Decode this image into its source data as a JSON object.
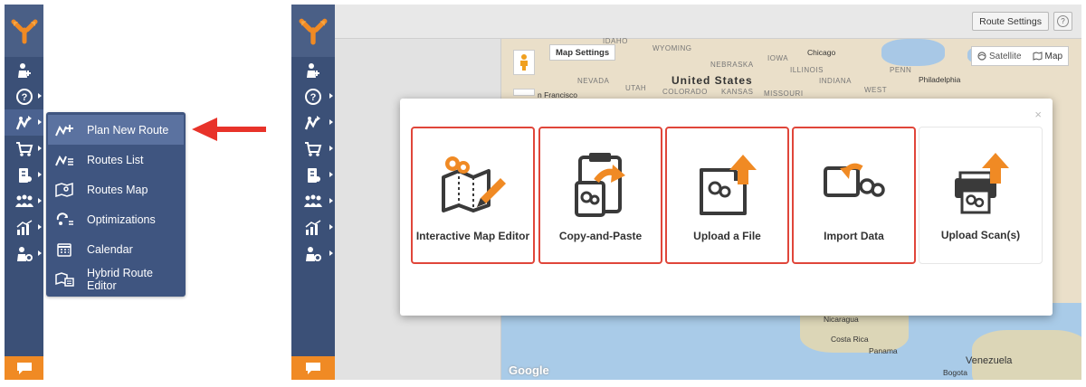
{
  "submenu": {
    "items": [
      {
        "label": "Plan New Route"
      },
      {
        "label": "Routes List"
      },
      {
        "label": "Routes Map"
      },
      {
        "label": "Optimizations"
      },
      {
        "label": "Calendar"
      },
      {
        "label": "Hybrid Route Editor"
      }
    ]
  },
  "toolbar": {
    "route_settings_label": "Route Settings",
    "help_label": "?"
  },
  "map": {
    "map_settings_label": "Map Settings",
    "satellite_label": "Satellite",
    "map_label": "Map",
    "google_label": "Google",
    "labels": {
      "country": "United States",
      "wyoming": "WYOMING",
      "nebraska": "NEBRASKA",
      "iowa": "IOWA",
      "illinois": "ILLINOIS",
      "indiana": "INDIANA",
      "penn": "PENN",
      "nevada": "NEVADA",
      "utah": "UTAH",
      "colorado": "COLORADO",
      "kansas": "KANSAS",
      "missouri": "MISSOURI",
      "west": "WEST",
      "idaho": "IDAHO",
      "chicago": "Chicago",
      "philadelphia": "Philadelphia",
      "san_francisco": "n Francisco",
      "nicaragua": "Nicaragua",
      "costa_rica": "Costa Rica",
      "panama": "Panama",
      "venezuela": "Venezuela",
      "bogota": "Bogota"
    }
  },
  "modal": {
    "close_label": "×",
    "cards": [
      {
        "label": "Interactive Map Editor",
        "outlined": true
      },
      {
        "label": "Copy-and-Paste",
        "outlined": true
      },
      {
        "label": "Upload a File",
        "outlined": true
      },
      {
        "label": "Import Data",
        "outlined": true
      },
      {
        "label": "Upload Scan(s)",
        "outlined": false
      }
    ]
  },
  "colors": {
    "sidebar": "#3b5077",
    "accent_orange": "#f08a24",
    "outline_red": "#e0463a",
    "arrow_red": "#e8332a"
  }
}
